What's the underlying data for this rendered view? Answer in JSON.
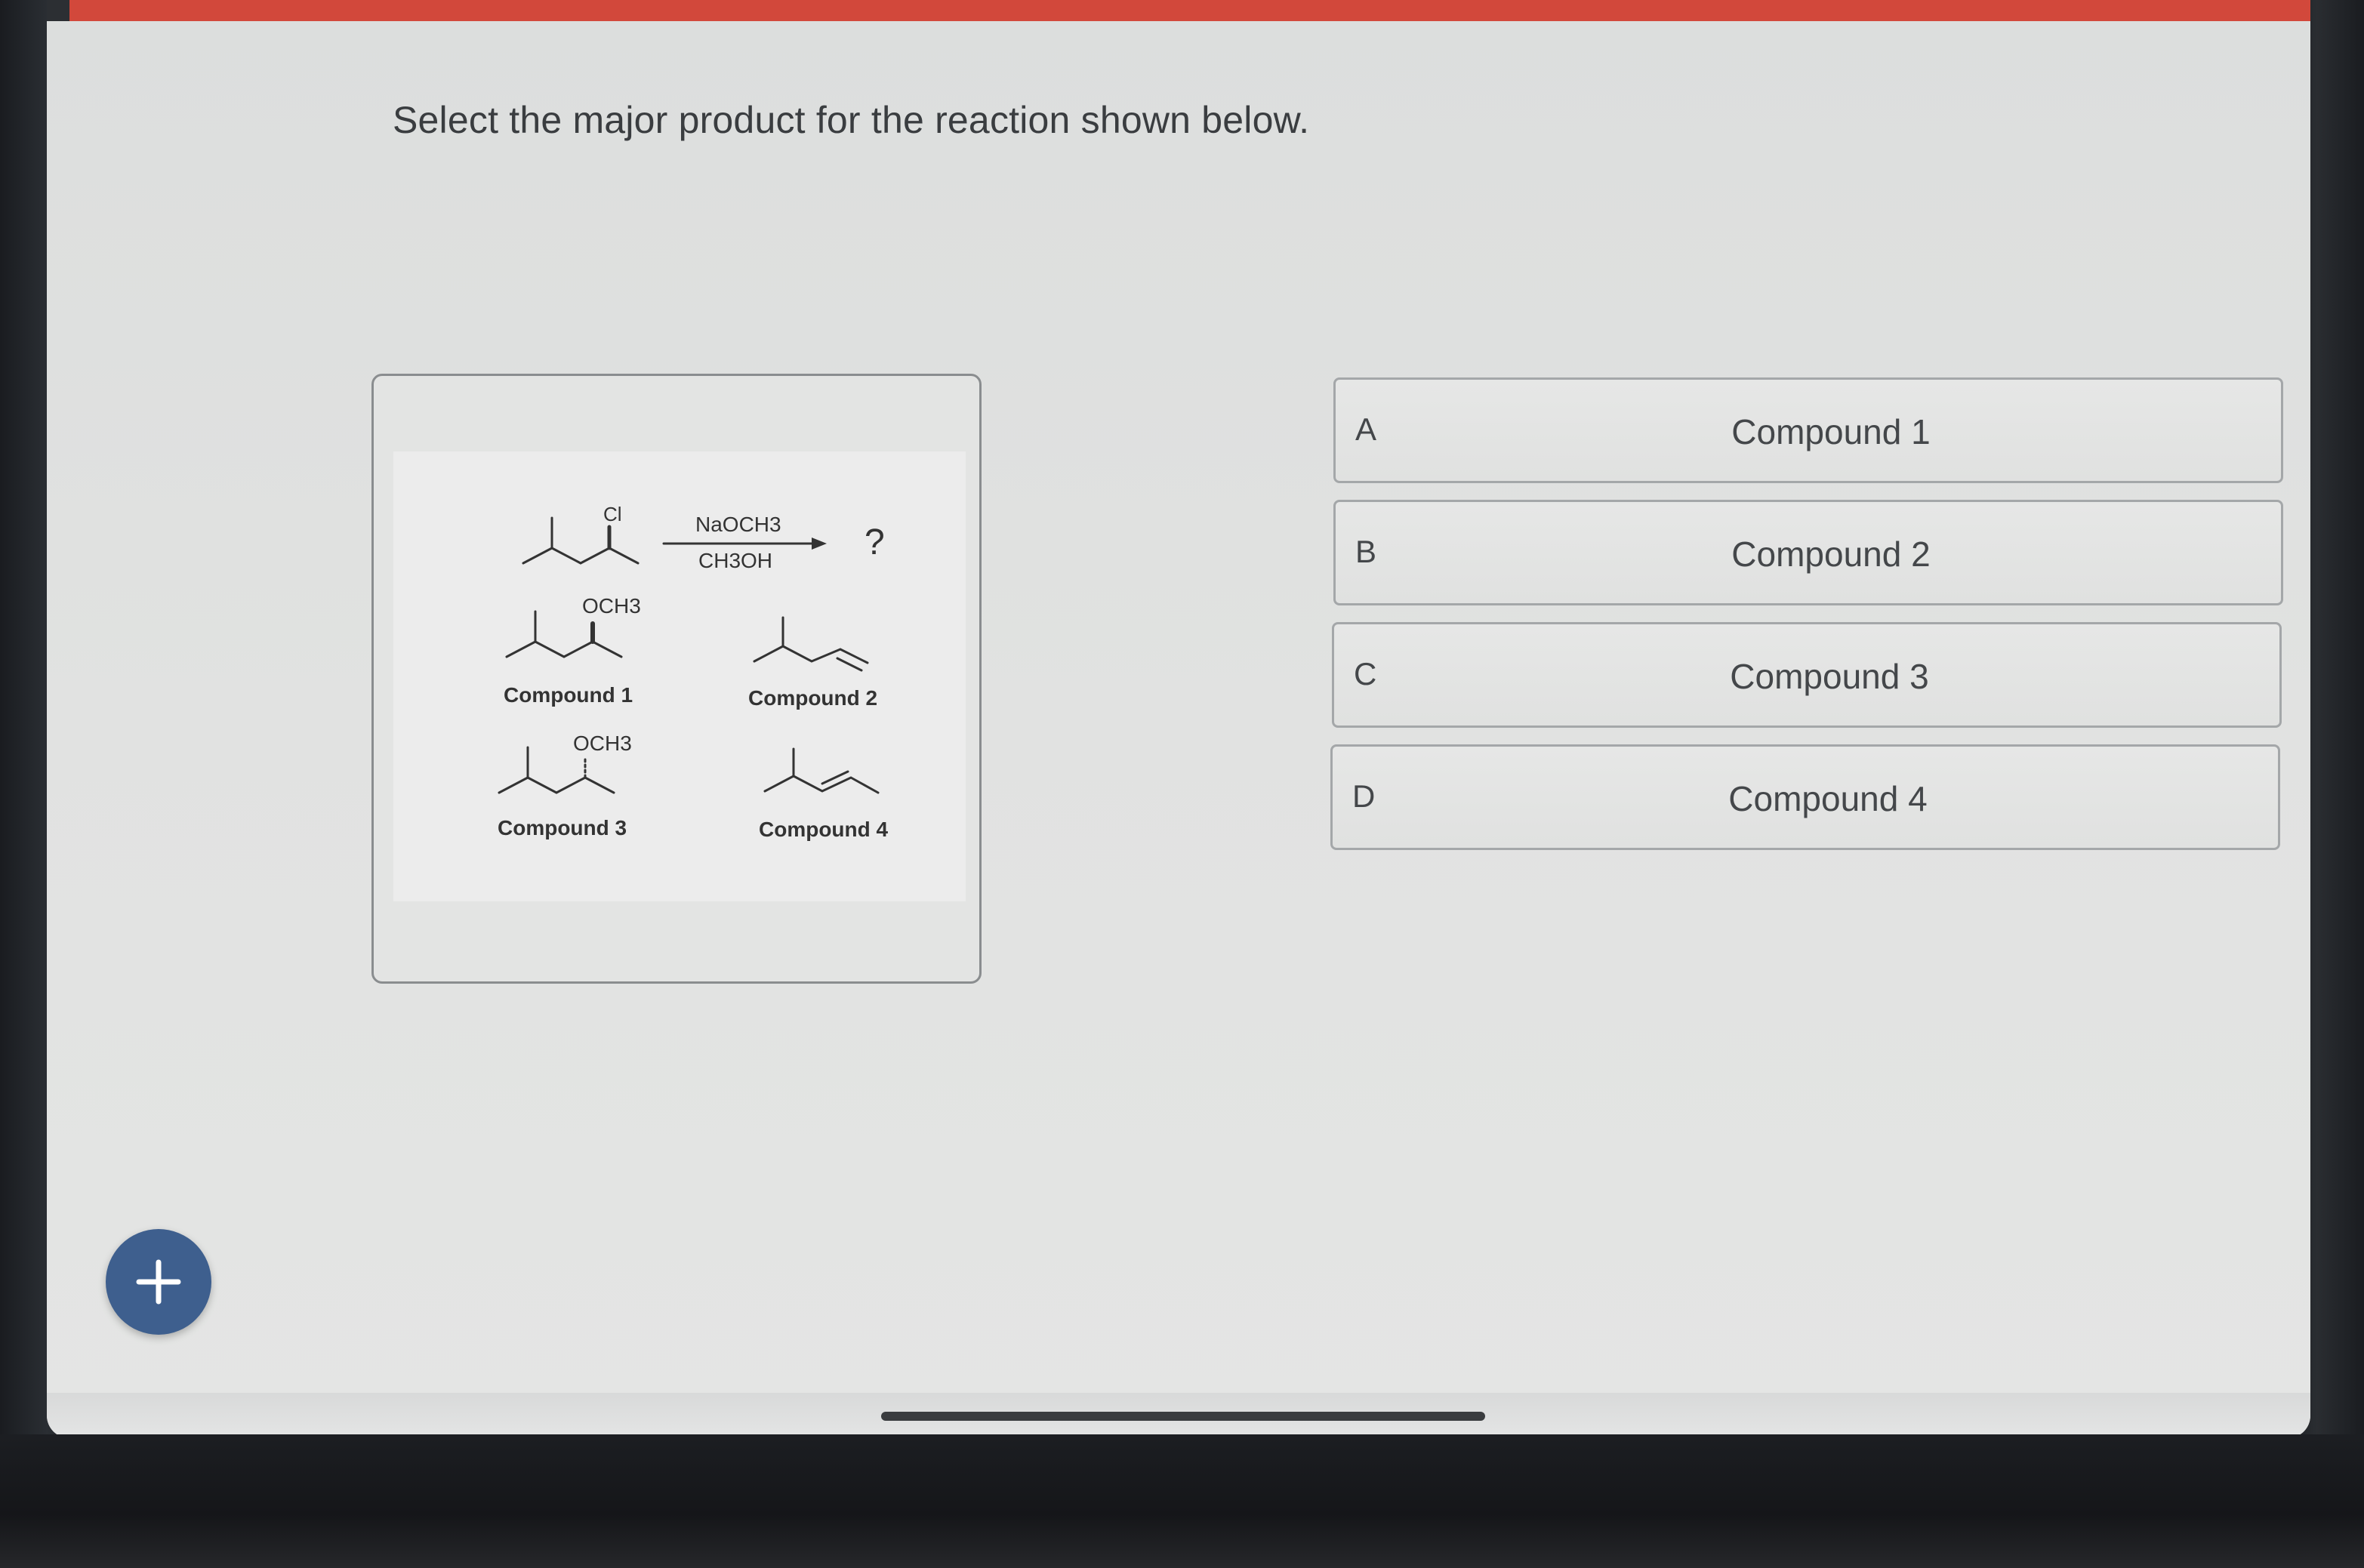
{
  "question": {
    "text": "Select the major product for the reaction shown below."
  },
  "reaction_image": {
    "reagent_top": "NaOCH3",
    "reagent_bottom": "CH3OH",
    "unknown": "?",
    "reactant_substituent": "Cl",
    "structures": [
      {
        "substituent": "OCH3",
        "label": "Compound 1"
      },
      {
        "substituent": "",
        "label": "Compound 2"
      },
      {
        "substituent": "OCH3",
        "label": "Compound 3"
      },
      {
        "substituent": "",
        "label": "Compound 4"
      }
    ]
  },
  "options": [
    {
      "letter": "A",
      "label": "Compound 1"
    },
    {
      "letter": "B",
      "label": "Compound 2"
    },
    {
      "letter": "C",
      "label": "Compound 3"
    },
    {
      "letter": "D",
      "label": "Compound 4"
    }
  ],
  "colors": {
    "top_bar": "#d2483b",
    "add_button": "#3e5f8e"
  },
  "icons": {
    "add_button": "plus-icon"
  }
}
